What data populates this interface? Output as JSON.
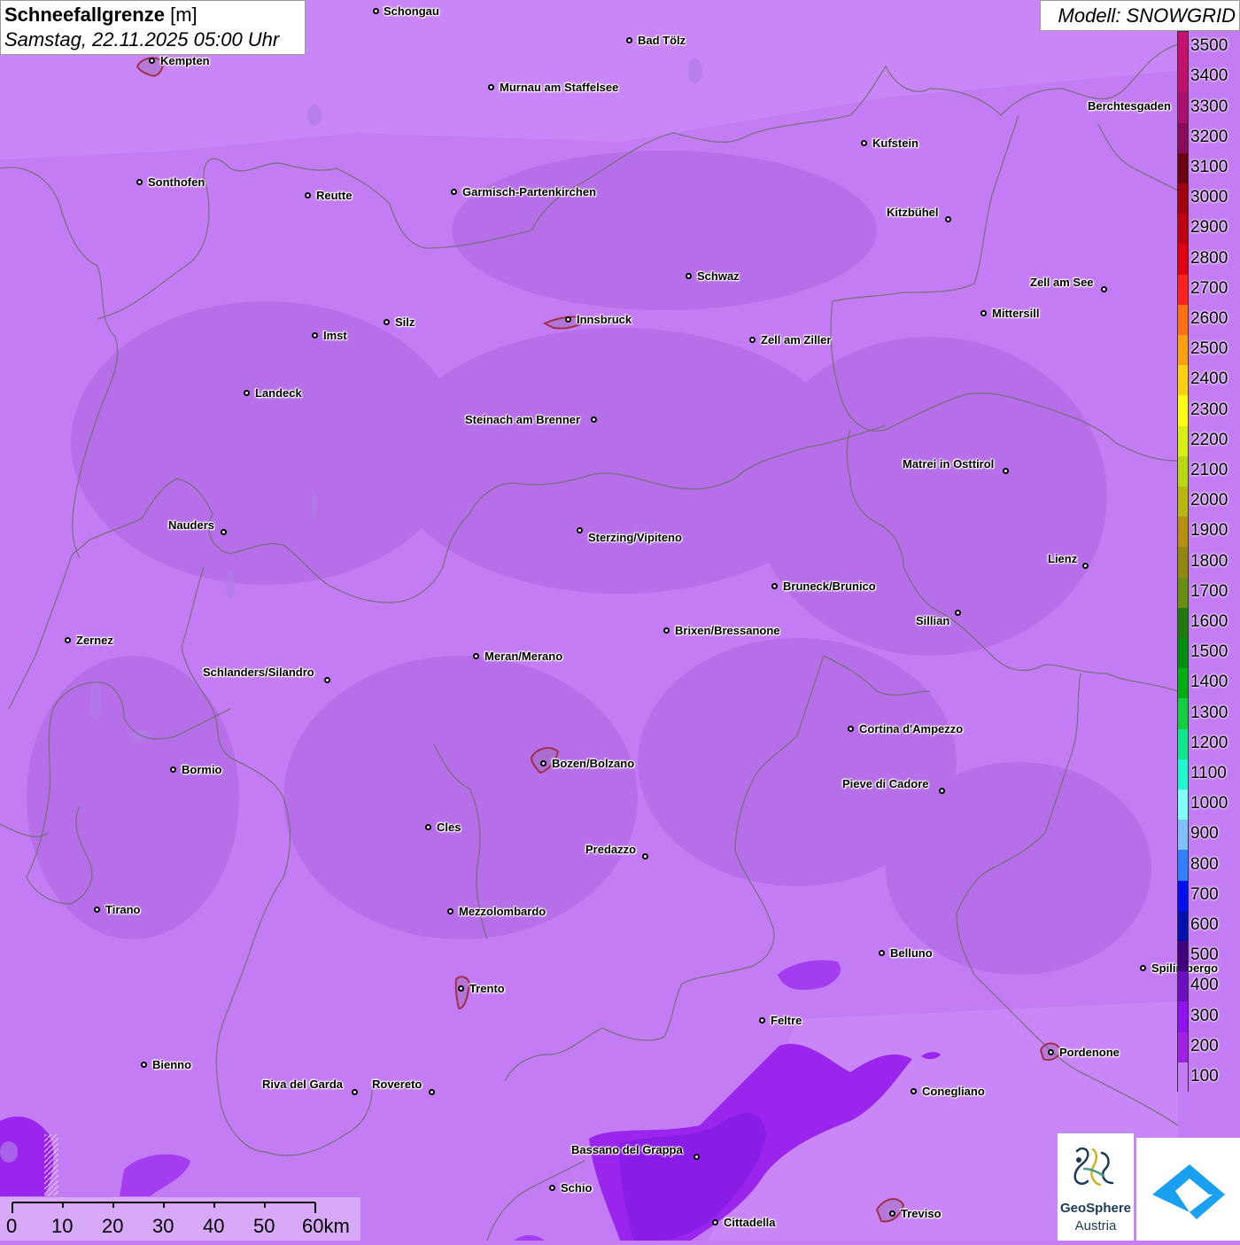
{
  "title": {
    "parameter": "Schneefallgrenze",
    "unit": "[m]",
    "datetime": "Samstag, 22.11.2025 05:00 Uhr"
  },
  "model": "Modell: SNOWGRID",
  "legend": {
    "labels": [
      "3500",
      "3400",
      "3300",
      "3200",
      "3100",
      "3000",
      "2900",
      "2800",
      "2700",
      "2600",
      "2500",
      "2400",
      "2300",
      "2200",
      "2100",
      "2000",
      "1900",
      "1800",
      "1700",
      "1600",
      "1500",
      "1400",
      "1300",
      "1200",
      "1100",
      "1000",
      "900",
      "800",
      "700",
      "600",
      "500",
      "400",
      "300",
      "200",
      "100"
    ],
    "colors": [
      "#c8106e",
      "#c0106a",
      "#a81070",
      "#8a0a5a",
      "#6a0010",
      "#a00010",
      "#c00010",
      "#e00010",
      "#ff2020",
      "#ff7010",
      "#ffa010",
      "#ffd010",
      "#ffff10",
      "#d8f010",
      "#b8d810",
      "#b8b810",
      "#b89010",
      "#908810",
      "#689010",
      "#207a10",
      "#009010",
      "#00b010",
      "#10d040",
      "#10e890",
      "#20f8d0",
      "#80fff8",
      "#80c0ff",
      "#3080ff",
      "#0010f0",
      "#0010b0",
      "#400080",
      "#6a10c0",
      "#9010f0",
      "#a020e8",
      "#c47cf5"
    ]
  },
  "cities": [
    {
      "name": "Schongau"
    },
    {
      "name": "Kempten"
    },
    {
      "name": "Bad Tölz"
    },
    {
      "name": "Murnau am Staffelsee"
    },
    {
      "name": "Berchtesgaden"
    },
    {
      "name": "Kufstein"
    },
    {
      "name": "Sonthofen"
    },
    {
      "name": "Reutte"
    },
    {
      "name": "Garmisch-Partenkirchen"
    },
    {
      "name": "Kitzbühel"
    },
    {
      "name": "Schwaz"
    },
    {
      "name": "Zell am See"
    },
    {
      "name": "Innsbruck"
    },
    {
      "name": "Mittersill"
    },
    {
      "name": "Imst"
    },
    {
      "name": "Silz"
    },
    {
      "name": "Zell am Ziller"
    },
    {
      "name": "Landeck"
    },
    {
      "name": "Steinach am Brenner"
    },
    {
      "name": "Matrei in Osttirol"
    },
    {
      "name": "Nauders"
    },
    {
      "name": "Sterzing/Vipiteno"
    },
    {
      "name": "Lienz"
    },
    {
      "name": "Bruneck/Brunico"
    },
    {
      "name": "Sillian"
    },
    {
      "name": "Zernez"
    },
    {
      "name": "Brixen/Bressanone"
    },
    {
      "name": "Meran/Merano"
    },
    {
      "name": "Schlanders/Silandro"
    },
    {
      "name": "Cortina d'Ampezzo"
    },
    {
      "name": "Bormio"
    },
    {
      "name": "Bozen/Bolzano"
    },
    {
      "name": "Pieve di Cadore"
    },
    {
      "name": "Cles"
    },
    {
      "name": "Predazzo"
    },
    {
      "name": "Tirano"
    },
    {
      "name": "Mezzolombardo"
    },
    {
      "name": "Belluno"
    },
    {
      "name": "Spilimbergo"
    },
    {
      "name": "Trento"
    },
    {
      "name": "Feltre"
    },
    {
      "name": "Pordenone"
    },
    {
      "name": "Bienno"
    },
    {
      "name": "Riva del Garda"
    },
    {
      "name": "Rovereto"
    },
    {
      "name": "Conegliano"
    },
    {
      "name": "Bassano del Grappa"
    },
    {
      "name": "Schio"
    },
    {
      "name": "Treviso"
    },
    {
      "name": "Cittadella"
    }
  ],
  "scalebar": {
    "labels": [
      "0",
      "10",
      "20",
      "30",
      "40",
      "50",
      "60km"
    ]
  },
  "logos": {
    "geosphere_line1": "GeoSphere",
    "geosphere_line2": "Austria"
  }
}
